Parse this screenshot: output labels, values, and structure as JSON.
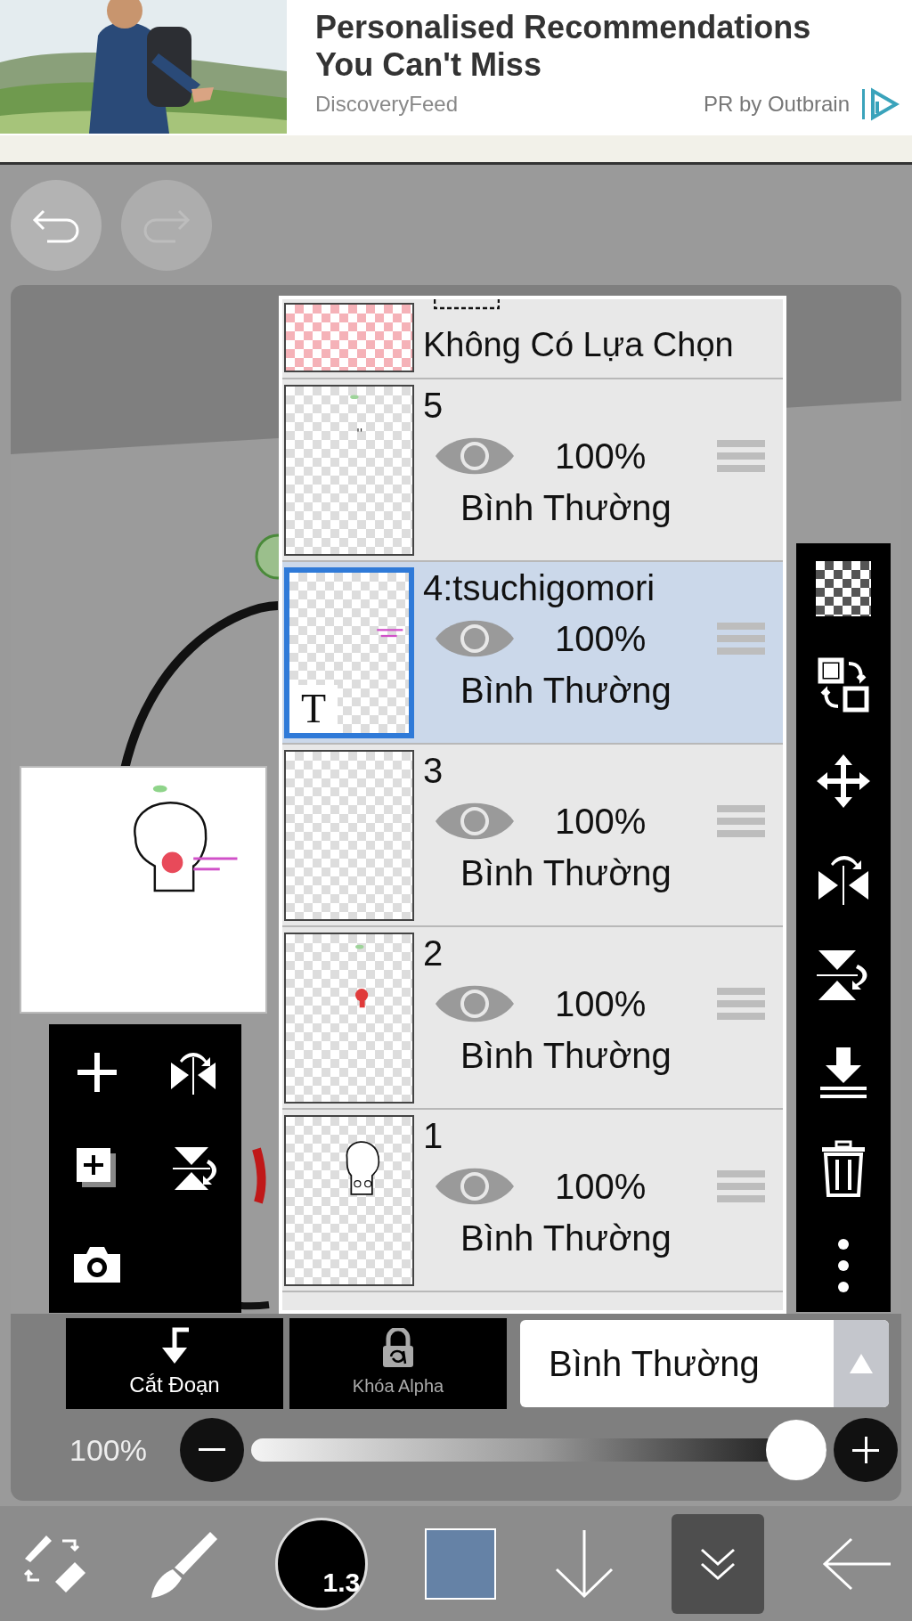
{
  "ad": {
    "headline": "Personalised Recommendations You Can't Miss",
    "source": "DiscoveryFeed",
    "sponsor": "PR by Outbrain"
  },
  "layers_panel": {
    "selection_layer": {
      "label": "Không Có Lựa Chọn"
    },
    "layers": [
      {
        "name": "5",
        "opacity": "100%",
        "blend": "Bình Thường",
        "selected": false,
        "visible": true,
        "kind": "raster"
      },
      {
        "name": "4:tsuchigomori",
        "opacity": "100%",
        "blend": "Bình Thường",
        "selected": true,
        "visible": true,
        "kind": "text",
        "badge": "T"
      },
      {
        "name": "3",
        "opacity": "100%",
        "blend": "Bình Thường",
        "selected": false,
        "visible": true,
        "kind": "raster"
      },
      {
        "name": "2",
        "opacity": "100%",
        "blend": "Bình Thường",
        "selected": false,
        "visible": true,
        "kind": "raster"
      },
      {
        "name": "1",
        "opacity": "100%",
        "blend": "Bình Thường",
        "selected": false,
        "visible": true,
        "kind": "raster"
      }
    ]
  },
  "layer_actions": [
    {
      "label": "Cắt Đoạn",
      "disabled": false
    },
    {
      "label": "Khóa Alpha",
      "disabled": true
    }
  ],
  "blend_mode": {
    "value": "Bình Thường"
  },
  "opacity": {
    "reading": "100%",
    "level": 1
  },
  "brush_size": "1.3"
}
